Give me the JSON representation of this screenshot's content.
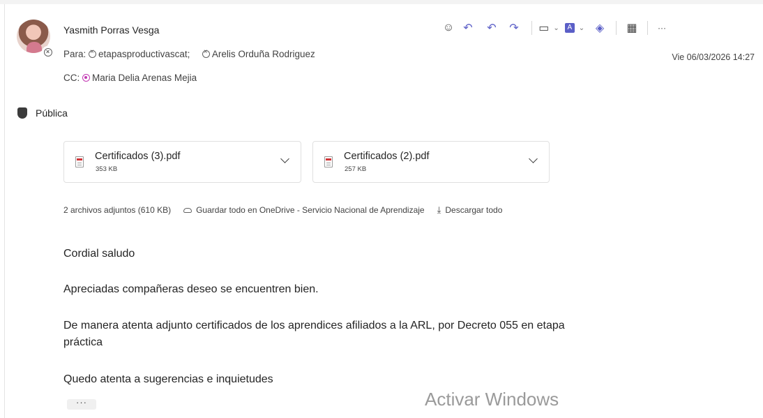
{
  "email": {
    "sender": "Yasmith Porras Vesga",
    "to_label": "Para:",
    "to_recipients": [
      "etapasproductivascat;",
      "Arelis Orduña Rodriguez"
    ],
    "cc_label": "CC:",
    "cc_recipients": [
      "Maria Delia Arenas Mejia"
    ],
    "date": "Vie 06/03/2026 14:27",
    "sensitivity_label": "Pública"
  },
  "toolbar": {
    "icons": [
      "emoji-icon",
      "reply-icon",
      "reply-all-icon",
      "forward-icon",
      "immersive-reader-icon",
      "pdf-icon",
      "loop-icon",
      "apps-icon",
      "more-icon"
    ],
    "more_label": "···"
  },
  "attachments": [
    {
      "name": "Certificados (3).pdf",
      "size": "353 KB"
    },
    {
      "name": "Certificados (2).pdf",
      "size": "257 KB"
    }
  ],
  "attachment_summary": {
    "count_text": "2 archivos adjuntos (610 KB)",
    "save_label": "Guardar todo en OneDrive - Servicio Nacional de Aprendizaje",
    "download_label": "Descargar todo"
  },
  "body": {
    "greeting": "Cordial saludo",
    "line1": "Apreciadas compañeras deseo se encuentren bien.",
    "line2a": "De manera atenta adjunto certificados de los aprendices afiliados a la ARL, por Decreto 055 en etapa",
    "line2b": "práctica",
    "line3": "Quedo atenta a sugerencias e inquietudes",
    "more_label": "···"
  },
  "watermark": "Activar Windows",
  "colors": {
    "accent": "#5b5fc7",
    "cc_presence": "#c239b3"
  }
}
